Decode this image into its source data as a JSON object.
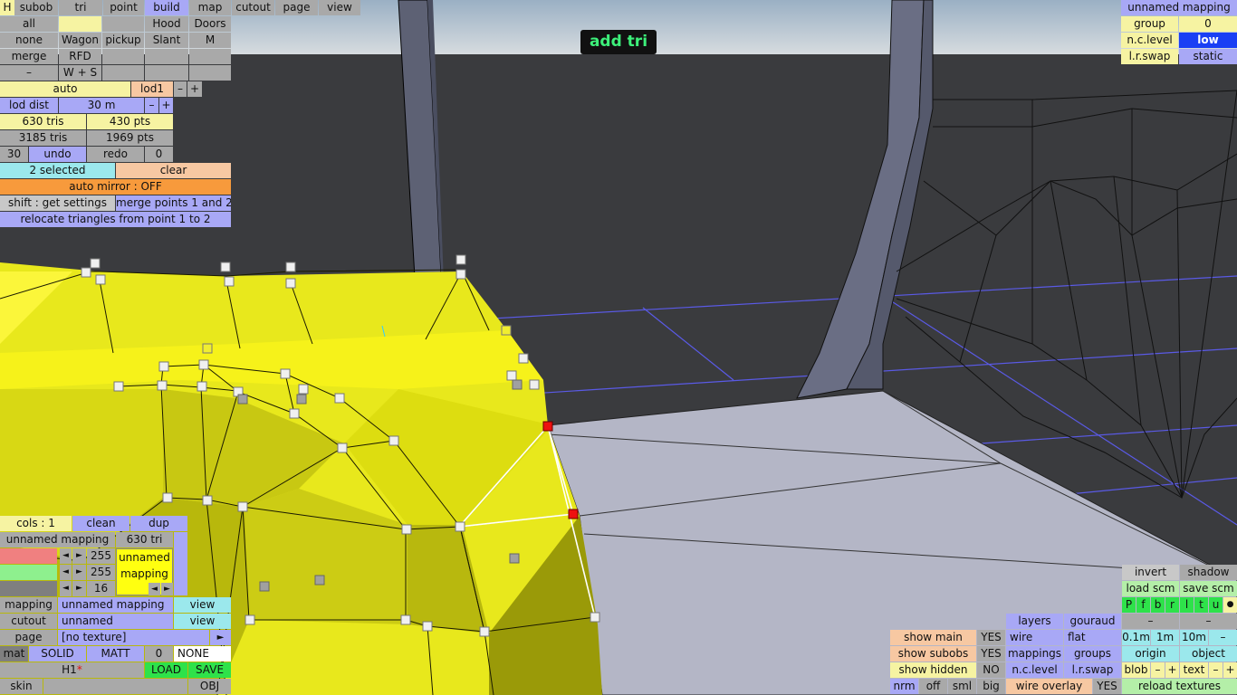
{
  "toolbar": {
    "h": "H",
    "subob": "subob",
    "tri": "tri",
    "point": "point",
    "build": "build",
    "map": "map",
    "cutout": "cutout",
    "page": "page",
    "view": "view"
  },
  "sel": {
    "all": "all",
    "none": "none",
    "merge": "merge",
    "dash": "–",
    "hood": "Hood",
    "doors": "Doors",
    "wagon": "Wagon",
    "pickup": "pickup",
    "slant": "Slant",
    "m": "M",
    "rfd": "RFD",
    "ws": "W + S"
  },
  "lod": {
    "auto": "auto",
    "lod1": "lod1",
    "minus": "–",
    "plus": "+",
    "lod_dist": "lod dist",
    "dist_value": "30 m",
    "tris": "630 tris",
    "pts": "430 pts",
    "total_tris": "3185 tris",
    "total_pts": "1969 pts"
  },
  "undo": {
    "count": "30",
    "undo": "undo",
    "redo": "redo",
    "redo_count": "0"
  },
  "selection": {
    "selected": "2 selected",
    "clear": "clear",
    "mirror": "auto mirror : OFF",
    "shift": "shift : get settings",
    "merge_points": "merge points 1 and 2",
    "relocate": "relocate triangles from point 1 to 2"
  },
  "status": {
    "mode": "add tri"
  },
  "top_right": {
    "mapping_name": "unnamed mapping",
    "group_label": "group",
    "group_value": "0",
    "nc_level_label": "n.c.level",
    "nc_level_value": "low",
    "lr_swap_label": "l.r.swap",
    "lr_swap_value": "static"
  },
  "colors": {
    "cols": "cols : 1",
    "clean": "clean",
    "dup": "dup",
    "mapping_name": "unnamed mapping",
    "tri_count": "630 tri",
    "r": "255",
    "g": "255",
    "b": "16",
    "swatch_line1": "unnamed",
    "swatch_line2": "mapping",
    "arrow_left": "◄",
    "arrow_right": "►"
  },
  "material": {
    "mapping_label": "mapping",
    "mapping_value": "unnamed mapping",
    "view": "view",
    "cutout_label": "cutout",
    "cutout_value": "unnamed",
    "page_label": "page",
    "page_value": "[no texture]",
    "page_arrow": "►",
    "mat": "mat",
    "solid": "SOLID",
    "matt": "MATT",
    "zero": "0",
    "none": "NONE",
    "h1": "H1",
    "star": "*",
    "load": "LOAD",
    "save": "SAVE",
    "skin": "skin",
    "obj": "OBJ"
  },
  "display": {
    "show_main": "show main",
    "show_main_v": "YES",
    "show_subobs": "show subobs",
    "show_subobs_v": "YES",
    "show_hidden": "show hidden",
    "show_hidden_v": "NO",
    "nrm": "nrm",
    "off": "off",
    "sml": "sml",
    "big": "big",
    "layers": "layers",
    "gouraud": "gouraud",
    "wire": "wire",
    "flat": "flat",
    "mappings": "mappings",
    "groups": "groups",
    "nc_level": "n.c.level",
    "lr_swap": "l.r.swap",
    "wire_overlay": "wire overlay",
    "wire_overlay_v": "YES"
  },
  "right_panel": {
    "invert": "invert",
    "shadow": "shadow",
    "load_scm": "load scm",
    "save_scm": "save scm",
    "flags": [
      "P",
      "f",
      "b",
      "r",
      "l",
      "t",
      "u"
    ],
    "dot": "●",
    "dash": "–",
    "s01": "0.1m",
    "s1": "1m",
    "s10": "10m",
    "origin": "origin",
    "object": "object",
    "blob": "blob",
    "text": "text",
    "minus": "–",
    "plus": "+",
    "reload": "reload textures"
  }
}
